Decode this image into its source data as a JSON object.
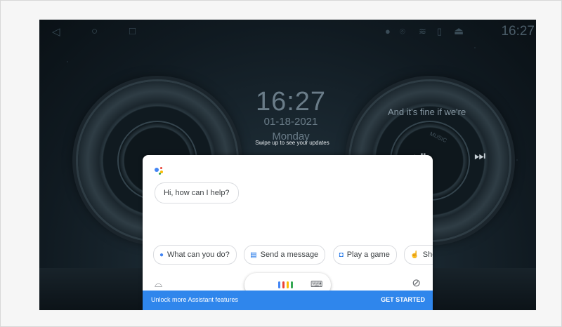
{
  "status_bar": {
    "time": "16:27",
    "icons": [
      "back-icon",
      "home-icon",
      "recents-icon",
      "mic-icon",
      "location-icon",
      "wifi-icon",
      "battery-icon",
      "eject-icon"
    ]
  },
  "clock": {
    "time": "16:27",
    "date": "01-18-2021",
    "day": "Monday",
    "swipe_hint": "Swipe up to see your updates"
  },
  "music": {
    "song": "And it's fine if we're",
    "label": "MUSIC"
  },
  "assistant": {
    "greeting": "Hi, how can I help?",
    "chips": [
      {
        "icon": "assistant-icon",
        "label": "What can you do?"
      },
      {
        "icon": "message-icon",
        "label": "Send a message"
      },
      {
        "icon": "gamepad-icon",
        "label": "Play a game"
      },
      {
        "icon": "finger-icon",
        "label": "Show"
      }
    ],
    "banner_text": "Unlock more Assistant features",
    "banner_button": "GET STARTED",
    "colors": {
      "blue": "#4285f4",
      "red": "#ea4335",
      "yellow": "#fbbc05",
      "green": "#34a853",
      "banner": "#2f86ec"
    }
  }
}
